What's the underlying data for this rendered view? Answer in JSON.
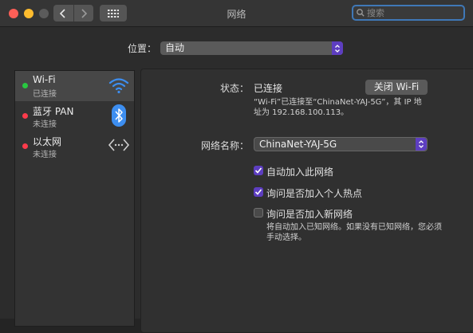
{
  "window": {
    "title": "网络"
  },
  "search": {
    "placeholder": "搜索"
  },
  "location": {
    "label": "位置：",
    "value": "自动"
  },
  "services": [
    {
      "name": "Wi-Fi",
      "status": "已连接",
      "status_color": "#28c840",
      "icon": "wifi-icon",
      "selected": true
    },
    {
      "name": "蓝牙 PAN",
      "status": "未连接",
      "status_color": "#fe3b4b",
      "icon": "bluetooth-icon",
      "selected": false
    },
    {
      "name": "以太网",
      "status": "未连接",
      "status_color": "#fe3b4b",
      "icon": "ethernet-icon",
      "selected": false
    }
  ],
  "detail": {
    "status_label": "状态：",
    "status_value": "已连接",
    "toggle_button": "关闭 Wi-Fi",
    "status_desc_line1": "“Wi-Fi”已连接至“ChinaNet-YAJ-5G”，其 IP 地",
    "status_desc_line2": "址为 192.168.100.113。",
    "network_name_label": "网络名称：",
    "network_name_value": "ChinaNet-YAJ-5G",
    "checkboxes": [
      {
        "label": "自动加入此网络",
        "checked": true
      },
      {
        "label": "询问是否加入个人热点",
        "checked": true
      },
      {
        "label": "询问是否加入新网络",
        "checked": false
      }
    ],
    "hint_line1": "将自动加入已知网络。如果没有已知网络，您必须",
    "hint_line2": "手动选择。"
  },
  "colors": {
    "accent": "#5d3ec0",
    "wifi_blue": "#3d8ef0"
  }
}
